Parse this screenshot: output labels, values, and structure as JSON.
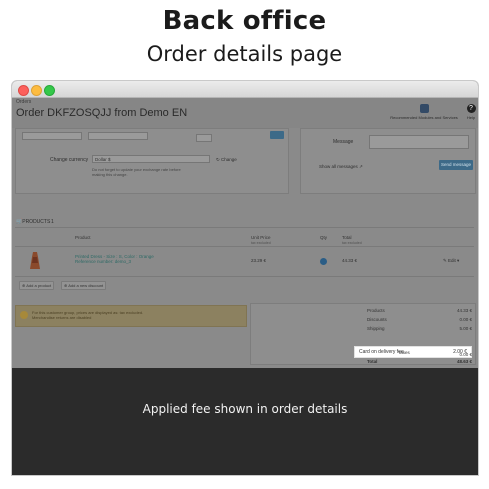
{
  "header": {
    "title": "Back office",
    "subtitle": "Order details page"
  },
  "app": {
    "breadcrumb": "Orders",
    "order_title": "Order DKFZOSQJJ from Demo EN",
    "toolbar": {
      "recommended_label": "Recommended Modules and Services",
      "help_label": "Help",
      "help_glyph": "?"
    },
    "currency": {
      "change_label": "Change currency",
      "selected_value": "Dollar $",
      "change_button": "Change",
      "help_line1": "Do not forget to update your exchange rate before",
      "help_line2": "making this change."
    },
    "messages": {
      "message_label": "Message",
      "show_all_label": "Show all messages",
      "send_button": "Send message"
    },
    "products": {
      "section_label": "PRODUCTS",
      "count": "1",
      "columns": {
        "product": "Product",
        "unit_price": "Unit Price",
        "unit_price_sub": "tax excluded",
        "qty": "Qty",
        "total": "Total",
        "total_sub": "tax excluded"
      },
      "row": {
        "name_line1": "Printed Dress - Size : S, Color : Orange",
        "name_line2": "Reference number: demo_3",
        "unit_price": "23.29 €",
        "total": "44.33 €",
        "edit_label": "Edit"
      },
      "add_product": "Add a product",
      "add_discount": "Add a new discount"
    },
    "warning": {
      "line1": "For this customer group, prices are displayed as: tax excluded.",
      "line2": "Merchandise returns are disabled"
    },
    "totals": {
      "rows": [
        {
          "label": "Products",
          "value": "44.33 €"
        },
        {
          "label": "Discounts",
          "value": "0.00 €"
        },
        {
          "label": "Shipping",
          "value": "5.00 €"
        },
        {
          "label": "Taxes",
          "value": "0.00 €"
        },
        {
          "label": "Total",
          "value": "48.63 €"
        }
      ],
      "fee_row": {
        "label": "Card on delivery fee",
        "value": "2.00 €"
      }
    }
  },
  "footer": {
    "caption": "Applied fee shown in order details"
  },
  "colors": {
    "overlay": "#7f7f7f",
    "footer": "#2b2b2b",
    "highlight": "#ffffff",
    "link": "#2d6a66",
    "button": "#3d6a88"
  }
}
